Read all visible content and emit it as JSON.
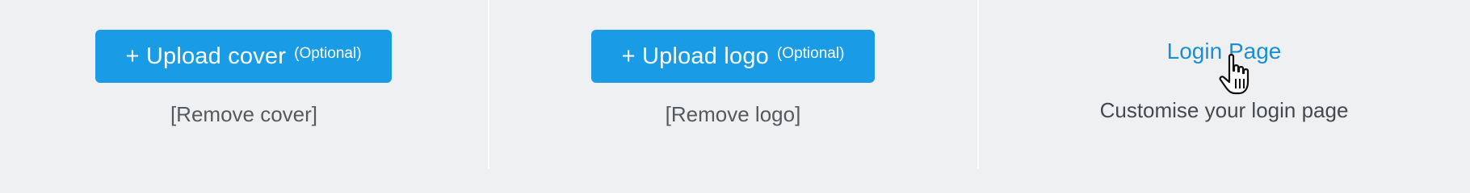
{
  "cover": {
    "upload_label": "+ Upload cover",
    "optional_label": "(Optional)",
    "remove_label": "[Remove cover]"
  },
  "logo": {
    "upload_label": "+ Upload logo",
    "optional_label": "(Optional)",
    "remove_label": "[Remove logo]"
  },
  "login": {
    "link_label": "Login Page",
    "description": "Customise your login page"
  },
  "colors": {
    "background": "#eff0f2",
    "accent": "#1a9be6",
    "link": "#1a8fd6",
    "muted_text": "#555a5f"
  },
  "icons": {
    "cursor": "hand-pointer-cursor-icon"
  }
}
